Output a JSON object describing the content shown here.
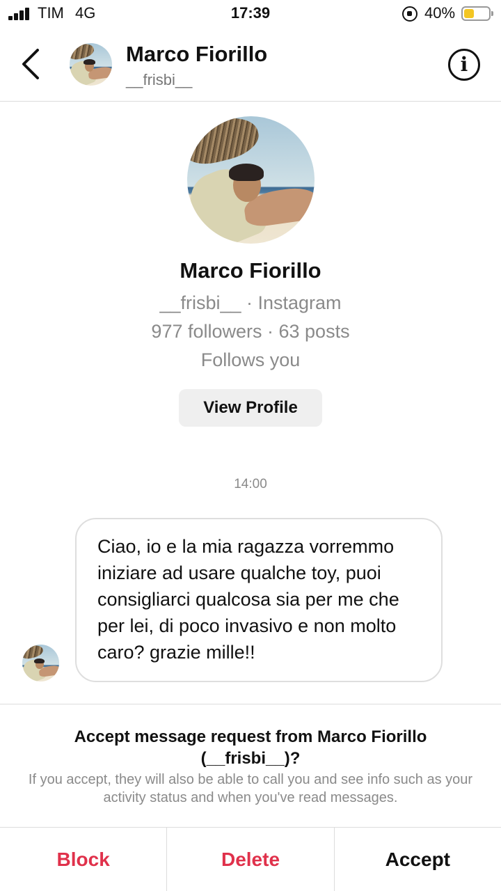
{
  "status_bar": {
    "carrier": "TIM",
    "network": "4G",
    "time": "17:39",
    "battery_percent": "40%",
    "battery_level": 0.4,
    "battery_color": "#f3c623"
  },
  "header": {
    "back_icon": "chevron-left-icon",
    "name": "Marco Fiorillo",
    "username": "__frisbi__",
    "info_icon": "info-icon",
    "info_glyph": "i"
  },
  "profile": {
    "name": "Marco Fiorillo",
    "source_line": "__frisbi__ · Instagram",
    "stats_line": "977 followers · 63 posts",
    "follows_line": "Follows you",
    "view_profile_label": "View Profile"
  },
  "conversation": {
    "timestamp": "14:00",
    "messages": [
      {
        "from": "Marco Fiorillo",
        "text": "Ciao, io e la mia ragazza vorremmo iniziare ad usare qualche toy, puoi consigliarci qualcosa sia per me che per lei, di poco invasivo e non molto caro? grazie mille!!"
      }
    ]
  },
  "request": {
    "title": "Accept message request from Marco Fiorillo (__frisbi__)?",
    "description": "If you accept, they will also be able to call you and see info such as your activity status and when you've read messages.",
    "block_label": "Block",
    "delete_label": "Delete",
    "accept_label": "Accept",
    "danger_color": "#e0314b"
  }
}
